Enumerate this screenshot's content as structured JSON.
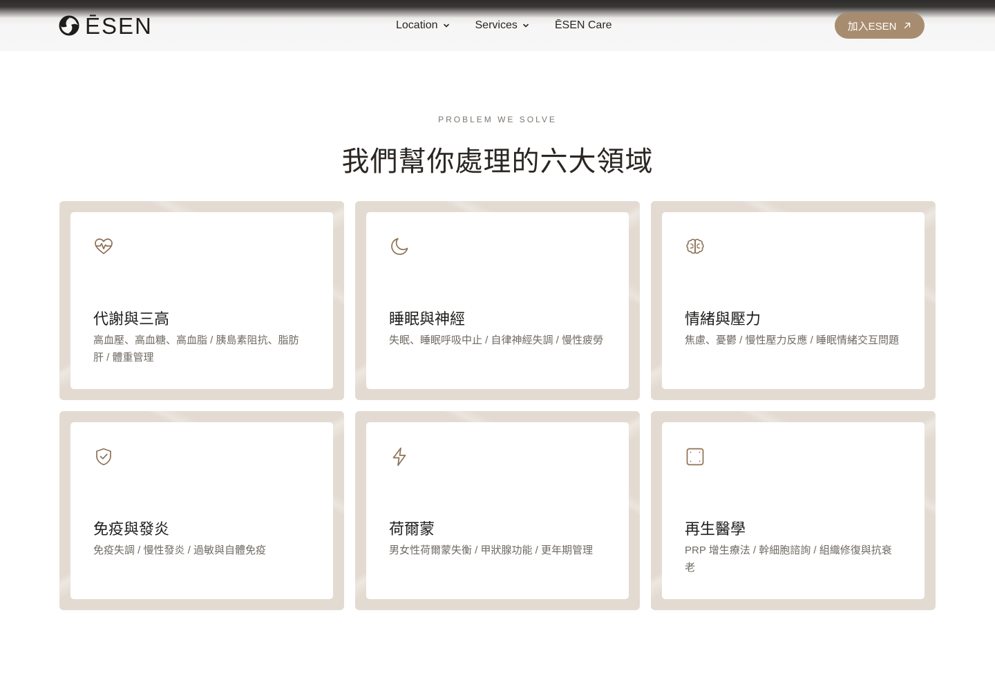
{
  "header": {
    "logo_text": "ĒSEN",
    "nav": [
      {
        "label": "Location",
        "has_dropdown": true
      },
      {
        "label": "Services",
        "has_dropdown": true
      },
      {
        "label": "ĒSEN Care",
        "has_dropdown": false
      }
    ],
    "cta_label": "加入ESEN",
    "cta_icon": "arrow-up-right-icon"
  },
  "section": {
    "eyebrow": "PROBLEM WE SOLVE",
    "title": "我們幫你處理的六大領域"
  },
  "cards": [
    {
      "icon": "heart-pulse-icon",
      "title": "代謝與三高",
      "desc": "高血壓、高血糖、高血脂 / 胰島素阻抗、脂肪肝 / 體重管理"
    },
    {
      "icon": "moon-icon",
      "title": "睡眠與神經",
      "desc": "失眠、睡眠呼吸中止 / 自律神經失調 / 慢性疲勞"
    },
    {
      "icon": "brain-icon",
      "title": "情緒與壓力",
      "desc": "焦慮、憂鬱 / 慢性壓力反應 / 睡眠情緒交互問題"
    },
    {
      "icon": "shield-check-icon",
      "title": "免疫與發炎",
      "desc": "免疫失調 / 慢性發炎 / 過敏與自體免疫"
    },
    {
      "icon": "lightning-icon",
      "title": "荷爾蒙",
      "desc": "男女性荷爾蒙失衡 / 甲狀腺功能 / 更年期管理"
    },
    {
      "icon": "square-dots-icon",
      "title": "再生醫學",
      "desc": "PRP 增生療法 / 幹細胞諮詢 / 組織修復與抗衰老"
    }
  ],
  "colors": {
    "accent": "#a88c6f",
    "frame": "#e3dbd1",
    "icon": "#8d7155"
  }
}
